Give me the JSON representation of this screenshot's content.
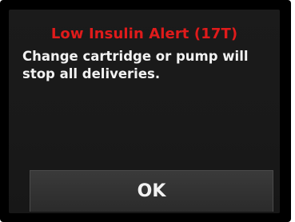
{
  "alert": {
    "title": "Low Insulin Alert (17T)",
    "message": "Change cartridge or pump will stop all deliveries.",
    "ok_label": "OK"
  },
  "colors": {
    "title": "#e01b1b",
    "text": "#f2f2f2",
    "background": "#1a1a1a",
    "button": "#333333"
  }
}
